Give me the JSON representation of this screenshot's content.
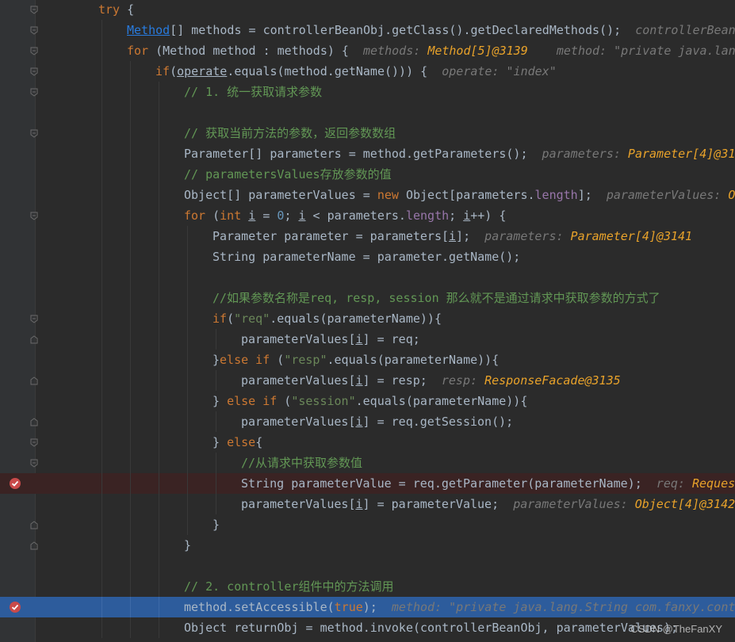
{
  "watermark": "CSDN @TheFanXY",
  "lines": [
    {
      "id": "l01",
      "t": [
        [
          "kw",
          "try"
        ],
        [
          "p",
          " {"
        ]
      ]
    },
    {
      "id": "l02",
      "t": [
        [
          "typelink",
          "Method"
        ],
        [
          "p",
          "[] methods = controllerBeanObj.getClass().getDeclaredMethods();"
        ],
        [
          "p",
          "  "
        ],
        [
          "hint-k",
          "controllerBean"
        ]
      ]
    },
    {
      "id": "l03",
      "t": [
        [
          "kw",
          "for"
        ],
        [
          "p",
          " (Method method : methods) {"
        ],
        [
          "p",
          "  "
        ],
        [
          "hint-k",
          "methods: "
        ],
        [
          "hint-v",
          "Method[5]@3139"
        ],
        [
          "p",
          "    "
        ],
        [
          "hint-k",
          "method: "
        ],
        [
          "hint-s",
          "\"private java.lan"
        ]
      ]
    },
    {
      "id": "l04",
      "t": [
        [
          "kw",
          "if"
        ],
        [
          "p",
          "("
        ],
        [
          "ul",
          "operate"
        ],
        [
          "p",
          ".equals(method.getName())) {"
        ],
        [
          "p",
          "  "
        ],
        [
          "hint-k",
          "operate: "
        ],
        [
          "hint-s",
          "\"index\""
        ]
      ]
    },
    {
      "id": "l05",
      "t": [
        [
          "cm",
          "// 1. 统一获取请求参数"
        ]
      ]
    },
    {
      "id": "l06",
      "t": []
    },
    {
      "id": "l07",
      "t": [
        [
          "cm",
          "// 获取当前方法的参数，返回参数数组"
        ]
      ]
    },
    {
      "id": "l08",
      "t": [
        [
          "p",
          "Parameter[] parameters = method.getParameters();"
        ],
        [
          "p",
          "  "
        ],
        [
          "hint-k",
          "parameters: "
        ],
        [
          "hint-v",
          "Parameter[4]@31"
        ]
      ]
    },
    {
      "id": "l09",
      "t": [
        [
          "cm",
          "// parametersValues存放参数的值"
        ]
      ]
    },
    {
      "id": "l10",
      "t": [
        [
          "p",
          "Object[] parameterValues = "
        ],
        [
          "kw",
          "new"
        ],
        [
          "p",
          " Object[parameters."
        ],
        [
          "fld",
          "length"
        ],
        [
          "p",
          "];"
        ],
        [
          "p",
          "  "
        ],
        [
          "hint-k",
          "parameterValues: "
        ],
        [
          "hint-v",
          "O"
        ]
      ]
    },
    {
      "id": "l11",
      "t": [
        [
          "kw",
          "for"
        ],
        [
          "p",
          " ("
        ],
        [
          "kw",
          "int"
        ],
        [
          "p",
          " "
        ],
        [
          "ul",
          "i"
        ],
        [
          "p",
          " = "
        ],
        [
          "num",
          "0"
        ],
        [
          "p",
          "; "
        ],
        [
          "ul",
          "i"
        ],
        [
          "p",
          " < parameters."
        ],
        [
          "fld",
          "length"
        ],
        [
          "p",
          "; "
        ],
        [
          "ul",
          "i"
        ],
        [
          "p",
          "++) {"
        ]
      ]
    },
    {
      "id": "l12",
      "t": [
        [
          "p",
          "Parameter parameter = parameters["
        ],
        [
          "ul",
          "i"
        ],
        [
          "p",
          "];"
        ],
        [
          "p",
          "  "
        ],
        [
          "hint-k",
          "parameters: "
        ],
        [
          "hint-v",
          "Parameter[4]@3141"
        ]
      ]
    },
    {
      "id": "l13",
      "t": [
        [
          "p",
          "String parameterName = parameter.getName();"
        ]
      ]
    },
    {
      "id": "l14",
      "t": []
    },
    {
      "id": "l15",
      "t": [
        [
          "cm",
          "//如果参数名称是req, resp, session 那么就不是通过请求中获取参数的方式了"
        ]
      ]
    },
    {
      "id": "l16",
      "t": [
        [
          "kw",
          "if"
        ],
        [
          "p",
          "("
        ],
        [
          "str",
          "\"req\""
        ],
        [
          "p",
          ".equals(parameterName)){"
        ]
      ]
    },
    {
      "id": "l17",
      "t": [
        [
          "p",
          "parameterValues["
        ],
        [
          "ul",
          "i"
        ],
        [
          "p",
          "] = req;"
        ]
      ]
    },
    {
      "id": "l18",
      "t": [
        [
          "p",
          "}"
        ],
        [
          "kw",
          "else if"
        ],
        [
          "p",
          " ("
        ],
        [
          "str",
          "\"resp\""
        ],
        [
          "p",
          ".equals(parameterName)){"
        ]
      ]
    },
    {
      "id": "l19",
      "t": [
        [
          "p",
          "parameterValues["
        ],
        [
          "ul",
          "i"
        ],
        [
          "p",
          "] = resp;"
        ],
        [
          "p",
          "  "
        ],
        [
          "hint-k",
          "resp: "
        ],
        [
          "hint-v",
          "ResponseFacade@3135"
        ]
      ]
    },
    {
      "id": "l20",
      "t": [
        [
          "p",
          "} "
        ],
        [
          "kw",
          "else if"
        ],
        [
          "p",
          " ("
        ],
        [
          "str",
          "\"session\""
        ],
        [
          "p",
          ".equals(parameterName)){"
        ]
      ]
    },
    {
      "id": "l21",
      "t": [
        [
          "p",
          "parameterValues["
        ],
        [
          "ul",
          "i"
        ],
        [
          "p",
          "] = req.getSession();"
        ]
      ]
    },
    {
      "id": "l22",
      "t": [
        [
          "p",
          "} "
        ],
        [
          "kw",
          "else"
        ],
        [
          "p",
          "{"
        ]
      ]
    },
    {
      "id": "l23",
      "t": [
        [
          "cm",
          "//从请求中获取参数值"
        ]
      ]
    },
    {
      "id": "l24",
      "t": [
        [
          "p",
          "String parameterValue = req.getParameter(parameterName);"
        ],
        [
          "p",
          "  "
        ],
        [
          "hint-k",
          "req: "
        ],
        [
          "hint-v",
          "Reques"
        ]
      ]
    },
    {
      "id": "l25",
      "t": [
        [
          "p",
          "parameterValues["
        ],
        [
          "ul",
          "i"
        ],
        [
          "p",
          "] = parameterValue;"
        ],
        [
          "p",
          "  "
        ],
        [
          "hint-k",
          "parameterValues: "
        ],
        [
          "hint-v",
          "Object[4]@3142"
        ]
      ]
    },
    {
      "id": "l26",
      "t": [
        [
          "p",
          "}"
        ]
      ]
    },
    {
      "id": "l27",
      "t": [
        [
          "p",
          "}"
        ]
      ]
    },
    {
      "id": "l28",
      "t": []
    },
    {
      "id": "l29",
      "t": [
        [
          "cm",
          "// 2. controller组件中的方法调用"
        ]
      ]
    },
    {
      "id": "l30",
      "t": [
        [
          "p",
          "method.setAccessible("
        ],
        [
          "kw",
          "true"
        ],
        [
          "p",
          ");"
        ],
        [
          "p",
          "  "
        ],
        [
          "hint-k",
          "method: "
        ],
        [
          "hint-s",
          "\"private java.lang.String com.fanxy.cont"
        ]
      ]
    },
    {
      "id": "l31",
      "t": [
        [
          "p",
          "Object returnObj = method.invoke(controllerBeanObj, parameterValues);"
        ]
      ]
    }
  ]
}
